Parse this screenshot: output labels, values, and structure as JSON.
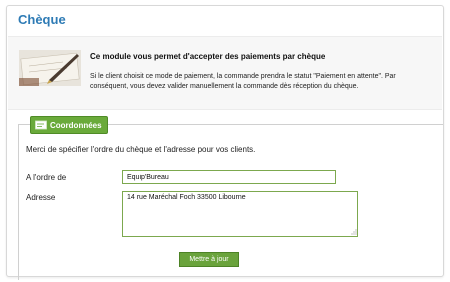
{
  "module": {
    "title": "Chèque"
  },
  "intro": {
    "title": "Ce module vous permet d'accepter des paiements par chèque",
    "text": "Si le client choisit ce mode de paiement, la commande prendra le statut \"Paiement en attente\". Par conséquent, vous devez valider manuellement la commande dès réception du chèque."
  },
  "coordonnees": {
    "legend": "Coordonnées",
    "description": "Merci de spécifier l'ordre du chèque et l'adresse pour vos clients.",
    "ordre_label": "A l'ordre de",
    "ordre_value": "Equip'Bureau",
    "adresse_label": "Adresse",
    "adresse_value": "14 rue Maréchal Foch 33500 Libourne",
    "submit_label": "Mettre à jour"
  },
  "colors": {
    "title": "#2e7bb5",
    "accent_green": "#6aaa3a",
    "field_border": "#7ca84e"
  }
}
